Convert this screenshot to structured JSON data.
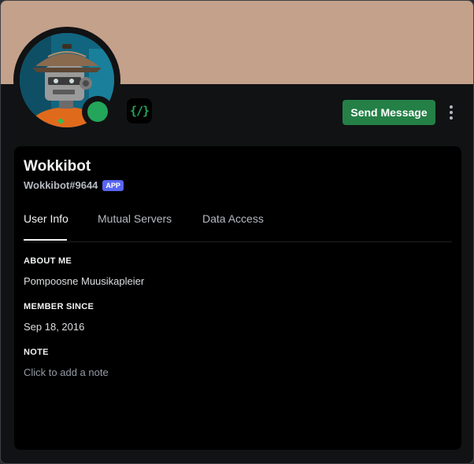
{
  "colors": {
    "banner": "#c4a18a",
    "status_online": "#23a55a",
    "send_button": "#248046",
    "app_badge": "#5865f2"
  },
  "profile": {
    "display_name": "Wokkibot",
    "username": "Wokkibot#9644",
    "app_badge": "APP",
    "status": "online",
    "avatar_icon": "robot-with-wok-hat-icon",
    "badge_icon": "slash-commands-icon",
    "badge_glyph": "{/}"
  },
  "actions": {
    "send_message_label": "Send Message",
    "more_icon": "vertical-ellipsis-icon"
  },
  "tabs": [
    {
      "label": "User Info",
      "active": true
    },
    {
      "label": "Mutual Servers",
      "active": false
    },
    {
      "label": "Data Access",
      "active": false
    }
  ],
  "sections": {
    "about_me": {
      "title": "ABOUT ME",
      "value": "Pompoosne Muusikapleier"
    },
    "member_since": {
      "title": "MEMBER SINCE",
      "value": "Sep 18, 2016"
    },
    "note": {
      "title": "NOTE",
      "placeholder": "Click to add a note"
    }
  }
}
